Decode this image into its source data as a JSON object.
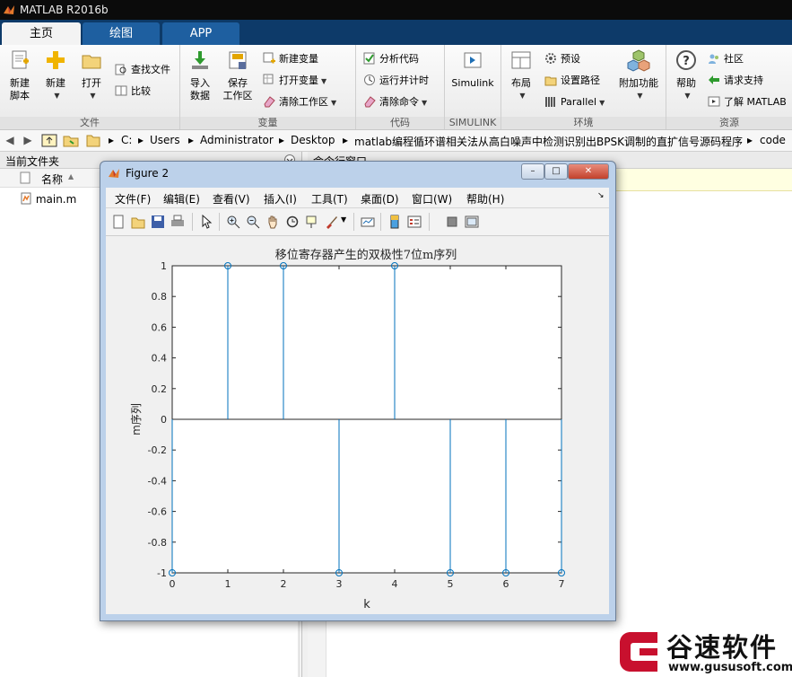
{
  "app": {
    "title": "MATLAB R2016b"
  },
  "tabs": [
    {
      "label": "主页",
      "active": true
    },
    {
      "label": "绘图",
      "active": false
    },
    {
      "label": "APP",
      "active": false
    }
  ],
  "ribbon": {
    "file_group": {
      "label": "文件",
      "new_script": "新建\n脚本",
      "new": "新建",
      "open": "打开",
      "find_files": "查找文件",
      "compare": "比较"
    },
    "variable_group": {
      "label": "变量",
      "import_data": "导入\n数据",
      "save_workspace": "保存\n工作区",
      "new_variable": "新建变量",
      "open_variable": "打开变量",
      "clear_workspace": "清除工作区"
    },
    "code_group": {
      "label": "代码",
      "analyze_code": "分析代码",
      "run_and_time": "运行并计时",
      "clear_commands": "清除命令"
    },
    "simulink_group": {
      "label": "SIMULINK",
      "simulink": "Simulink"
    },
    "env_group": {
      "label": "环境",
      "layout": "布局",
      "preferences": "预设",
      "set_path": "设置路径",
      "parallel": "Parallel",
      "addons": "附加功能"
    },
    "resources_group": {
      "label": "资源",
      "help": "帮助",
      "community": "社区",
      "request_support": "请求支持",
      "learn_matlab": "了解 MATLAB"
    }
  },
  "address": {
    "crumbs": [
      "C:",
      "Users",
      "Administrator",
      "Desktop",
      "matlab编程循环谱相关法从高白噪声中检测识别出BPSK调制的直扩信号源码程序",
      "code"
    ]
  },
  "current_folder": {
    "title": "当前文件夹",
    "column_name": "名称",
    "files": [
      "main.m"
    ]
  },
  "command_window": {
    "title": "命令行窗口"
  },
  "figure": {
    "title": "Figure 2",
    "menu": [
      "文件(F)",
      "编辑(E)",
      "查看(V)",
      "插入(I)",
      "工具(T)",
      "桌面(D)",
      "窗口(W)",
      "帮助(H)"
    ]
  },
  "chart_data": {
    "type": "stem",
    "title": "移位寄存器产生的双极性7位m序列",
    "xlabel": "k",
    "ylabel": "m序列",
    "x": [
      0,
      1,
      2,
      3,
      4,
      5,
      6,
      7
    ],
    "values": [
      -1,
      1,
      1,
      -1,
      1,
      -1,
      -1,
      -1
    ],
    "xlim": [
      0,
      7
    ],
    "ylim": [
      -1,
      1
    ],
    "xticks": [
      "0",
      "1",
      "2",
      "3",
      "4",
      "5",
      "6",
      "7"
    ],
    "yticks": [
      "1",
      "0.8",
      "0.6",
      "0.4",
      "0.2",
      "0",
      "-0.2",
      "-0.4",
      "-0.6",
      "-0.8",
      "-1"
    ],
    "grid": false,
    "color": "#0072bd"
  },
  "watermark": {
    "brand": "谷速软件",
    "url": "www.gususoft.com",
    "color": "#c8102e"
  }
}
